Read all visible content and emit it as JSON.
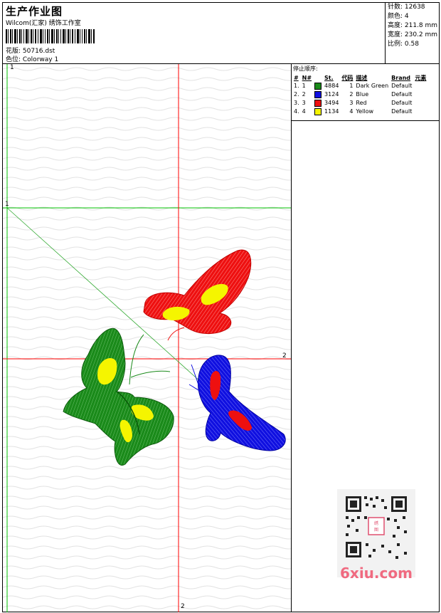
{
  "header": {
    "title": "生产作业图",
    "subtitle": "Wilcom(汇家) 绣饰工作室",
    "design_label": "花版: 50716.dst",
    "colorway_label": "色位: Colorway 1"
  },
  "stats": {
    "stitches": "针数: 12638",
    "colors": "颜色: 4",
    "height": "高度: 211.8 mm",
    "width": "宽度: 230.2 mm",
    "scale": "比例: 0.58"
  },
  "stop_sequence": {
    "title": "停止顺序:",
    "columns": [
      "#",
      "N#",
      "St.",
      "代码",
      "描述",
      "Brand",
      "元素"
    ],
    "rows": [
      {
        "num": "1.",
        "needle": "1",
        "color": "#1a8a1a",
        "stitches": "4884",
        "code": "1",
        "desc": "Dark Green",
        "brand": "Default"
      },
      {
        "num": "2.",
        "needle": "2",
        "color": "#1010e0",
        "stitches": "3124",
        "code": "2",
        "desc": "Blue",
        "brand": "Default"
      },
      {
        "num": "3.",
        "needle": "3",
        "color": "#ee1010",
        "stitches": "3494",
        "code": "3",
        "desc": "Red",
        "brand": "Default"
      },
      {
        "num": "4.",
        "needle": "4",
        "color": "#f5f500",
        "stitches": "1134",
        "code": "4",
        "desc": "Yellow",
        "brand": "Default"
      }
    ]
  },
  "axis_labels": {
    "green_top": "1",
    "green_left": "1",
    "red_right": "2",
    "red_bottom": "2"
  },
  "watermark": "6xiu.com",
  "colors": {
    "green": "#1a8a1a",
    "blue": "#1010e0",
    "red": "#ee1010",
    "yellow": "#f5f500",
    "guide_red": "#ff0000",
    "guide_green": "#00c000"
  }
}
